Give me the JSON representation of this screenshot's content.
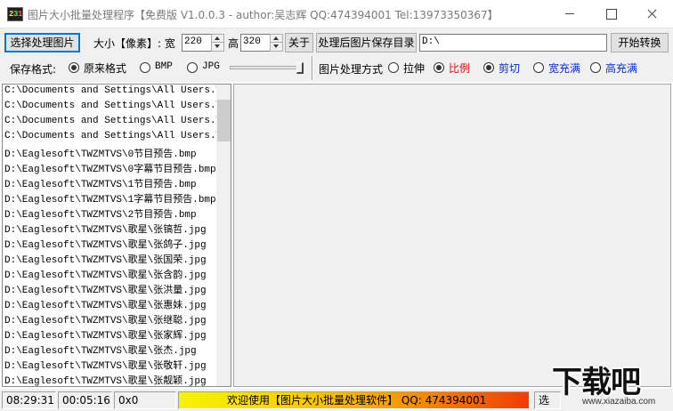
{
  "window": {
    "icon_chars": [
      "2",
      "3",
      "1"
    ],
    "title": "图片大小批量处理程序【免费版 V1.0.0.3 - author:吴志辉  QQ:474394001 Tel:13973350367】"
  },
  "toolbar": {
    "select_button": "选择处理图片",
    "size_label": "大小【像素】: 宽",
    "width_value": "220",
    "height_label": "高",
    "height_value": "320",
    "about_button": "关于",
    "save_dir_button": "处理后图片保存目录",
    "save_dir_value": "D:\\",
    "start_button": "开始转换"
  },
  "options": {
    "format_label": "保存格式:",
    "format_original": "原来格式",
    "format_bmp": "BMP",
    "format_jpg": "JPG",
    "method_label": "图片处理方式",
    "method_stretch": "拉伸",
    "method_ratio": "比例",
    "method_crop": "剪切",
    "method_fill_width": "宽充满",
    "method_fill_height": "高充满"
  },
  "files": [
    "C:\\Documents and Settings\\All Users.WINDOWS",
    "C:\\Documents and Settings\\All Users.WINDOWS",
    "C:\\Documents and Settings\\All Users.WINDOWS",
    "C:\\Documents and Settings\\All Users.WINDOWS",
    "D:\\Eaglesoft\\TWZMTVS\\0节目预告.bmp",
    "D:\\Eaglesoft\\TWZMTVS\\0字幕节目预告.bmp",
    "D:\\Eaglesoft\\TWZMTVS\\1节目预告.bmp",
    "D:\\Eaglesoft\\TWZMTVS\\1字幕节目预告.bmp",
    "D:\\Eaglesoft\\TWZMTVS\\2节目预告.bmp",
    "D:\\Eaglesoft\\TWZMTVS\\歌星\\张镐哲.jpg",
    "D:\\Eaglesoft\\TWZMTVS\\歌星\\张鸽子.jpg",
    "D:\\Eaglesoft\\TWZMTVS\\歌星\\张国荣.jpg",
    "D:\\Eaglesoft\\TWZMTVS\\歌星\\张含韵.jpg",
    "D:\\Eaglesoft\\TWZMTVS\\歌星\\张洪量.jpg",
    "D:\\Eaglesoft\\TWZMTVS\\歌星\\张惠妹.jpg",
    "D:\\Eaglesoft\\TWZMTVS\\歌星\\张继聪.jpg",
    "D:\\Eaglesoft\\TWZMTVS\\歌星\\张家辉.jpg",
    "D:\\Eaglesoft\\TWZMTVS\\歌星\\张杰.jpg",
    "D:\\Eaglesoft\\TWZMTVS\\歌星\\张敬轩.jpg",
    "D:\\Eaglesoft\\TWZMTVS\\歌星\\张靓颖.jpg"
  ],
  "status": {
    "clock": "08:29:31",
    "elapsed": "00:05:16",
    "hex": "0x0",
    "welcome": "欢迎使用【图片大小批量处理软件】 QQ: 474394001",
    "cut_label": "选"
  },
  "watermark": {
    "big": "下载吧",
    "small": "www.xiazaiba.com"
  }
}
